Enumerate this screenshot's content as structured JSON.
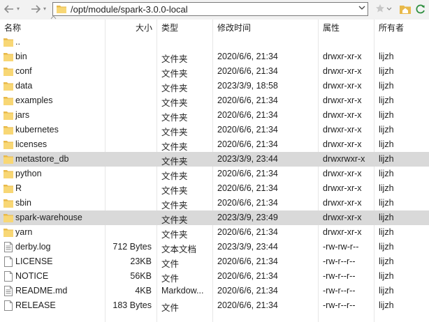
{
  "toolbar": {
    "back_icon": "arrow-left-icon",
    "forward_icon": "arrow-right-icon",
    "path": "/opt/module/spark-3.0.0-local"
  },
  "headers": {
    "name": "名称",
    "size": "大小",
    "type": "类型",
    "modified": "修改时间",
    "attributes": "属性",
    "owner": "所有者"
  },
  "rows": [
    {
      "icon": "folder-icon",
      "name": "..",
      "size": "",
      "type": "",
      "modified": "",
      "attributes": "",
      "owner": "",
      "selected": false
    },
    {
      "icon": "folder-icon",
      "name": "bin",
      "size": "",
      "type": "文件夹",
      "modified": "2020/6/6, 21:34",
      "attributes": "drwxr-xr-x",
      "owner": "lijzh",
      "selected": false
    },
    {
      "icon": "folder-icon",
      "name": "conf",
      "size": "",
      "type": "文件夹",
      "modified": "2020/6/6, 21:34",
      "attributes": "drwxr-xr-x",
      "owner": "lijzh",
      "selected": false
    },
    {
      "icon": "folder-icon",
      "name": "data",
      "size": "",
      "type": "文件夹",
      "modified": "2023/3/9, 18:58",
      "attributes": "drwxr-xr-x",
      "owner": "lijzh",
      "selected": false
    },
    {
      "icon": "folder-icon",
      "name": "examples",
      "size": "",
      "type": "文件夹",
      "modified": "2020/6/6, 21:34",
      "attributes": "drwxr-xr-x",
      "owner": "lijzh",
      "selected": false
    },
    {
      "icon": "folder-icon",
      "name": "jars",
      "size": "",
      "type": "文件夹",
      "modified": "2020/6/6, 21:34",
      "attributes": "drwxr-xr-x",
      "owner": "lijzh",
      "selected": false
    },
    {
      "icon": "folder-icon",
      "name": "kubernetes",
      "size": "",
      "type": "文件夹",
      "modified": "2020/6/6, 21:34",
      "attributes": "drwxr-xr-x",
      "owner": "lijzh",
      "selected": false
    },
    {
      "icon": "folder-icon",
      "name": "licenses",
      "size": "",
      "type": "文件夹",
      "modified": "2020/6/6, 21:34",
      "attributes": "drwxr-xr-x",
      "owner": "lijzh",
      "selected": false
    },
    {
      "icon": "folder-icon",
      "name": "metastore_db",
      "size": "",
      "type": "文件夹",
      "modified": "2023/3/9, 23:44",
      "attributes": "drwxrwxr-x",
      "owner": "lijzh",
      "selected": true
    },
    {
      "icon": "folder-icon",
      "name": "python",
      "size": "",
      "type": "文件夹",
      "modified": "2020/6/6, 21:34",
      "attributes": "drwxr-xr-x",
      "owner": "lijzh",
      "selected": false
    },
    {
      "icon": "folder-icon",
      "name": "R",
      "size": "",
      "type": "文件夹",
      "modified": "2020/6/6, 21:34",
      "attributes": "drwxr-xr-x",
      "owner": "lijzh",
      "selected": false
    },
    {
      "icon": "folder-icon",
      "name": "sbin",
      "size": "",
      "type": "文件夹",
      "modified": "2020/6/6, 21:34",
      "attributes": "drwxr-xr-x",
      "owner": "lijzh",
      "selected": false
    },
    {
      "icon": "folder-icon",
      "name": "spark-warehouse",
      "size": "",
      "type": "文件夹",
      "modified": "2023/3/9, 23:49",
      "attributes": "drwxr-xr-x",
      "owner": "lijzh",
      "selected": true
    },
    {
      "icon": "folder-icon",
      "name": "yarn",
      "size": "",
      "type": "文件夹",
      "modified": "2020/6/6, 21:34",
      "attributes": "drwxr-xr-x",
      "owner": "lijzh",
      "selected": false
    },
    {
      "icon": "text-file-icon",
      "name": "derby.log",
      "size": "712 Bytes",
      "type": "文本文档",
      "modified": "2023/3/9, 23:44",
      "attributes": "-rw-rw-r--",
      "owner": "lijzh",
      "selected": false
    },
    {
      "icon": "file-icon",
      "name": "LICENSE",
      "size": "23KB",
      "type": "文件",
      "modified": "2020/6/6, 21:34",
      "attributes": "-rw-r--r--",
      "owner": "lijzh",
      "selected": false
    },
    {
      "icon": "file-icon",
      "name": "NOTICE",
      "size": "56KB",
      "type": "文件",
      "modified": "2020/6/6, 21:34",
      "attributes": "-rw-r--r--",
      "owner": "lijzh",
      "selected": false
    },
    {
      "icon": "text-file-icon",
      "name": "README.md",
      "size": "4KB",
      "type": "Markdow...",
      "modified": "2020/6/6, 21:34",
      "attributes": "-rw-r--r--",
      "owner": "lijzh",
      "selected": false
    },
    {
      "icon": "file-icon",
      "name": "RELEASE",
      "size": "183 Bytes",
      "type": "文件",
      "modified": "2020/6/6, 21:34",
      "attributes": "-rw-r--r--",
      "owner": "lijzh",
      "selected": false
    }
  ]
}
